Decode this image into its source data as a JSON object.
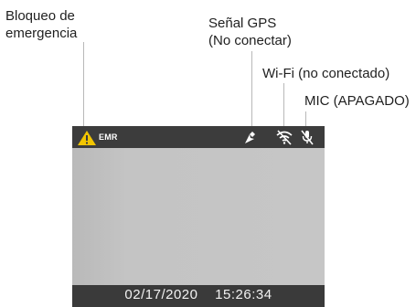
{
  "callouts": {
    "emergency_line1": "Bloqueo de",
    "emergency_line2": "emergencia",
    "gps_line1": "Señal GPS",
    "gps_line2": "(No conectar)",
    "wifi": "Wi-Fi (no conectado)",
    "mic": "MIC (APAGADO)"
  },
  "status_bar": {
    "emr_label": "EMR",
    "icons": [
      "warning-triangle-icon",
      "gps-satellite-icon",
      "wifi-off-icon",
      "mic-off-icon"
    ]
  },
  "footer": {
    "date": "02/17/2020",
    "time": "15:26:34"
  },
  "colors": {
    "warning": "#f2c500",
    "status_bar": "#3c3c3c",
    "screen": "#c2c2c2",
    "callout_line": "#b8b8b8"
  }
}
